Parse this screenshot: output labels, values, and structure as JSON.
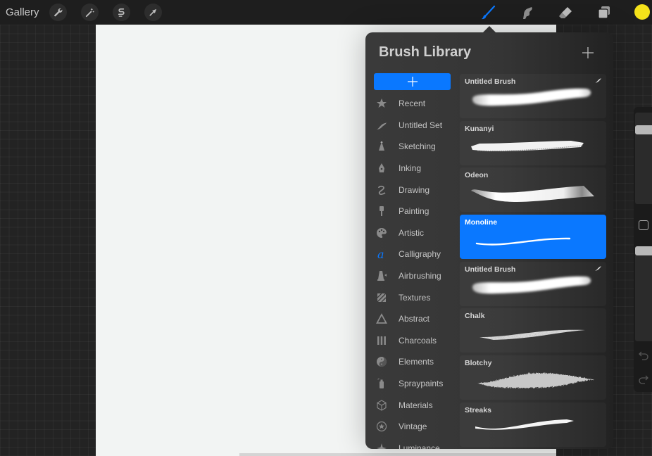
{
  "topbar": {
    "gallery_label": "Gallery",
    "left_tools": [
      {
        "name": "actions",
        "icon": "wrench-icon"
      },
      {
        "name": "adjustments",
        "icon": "magic-wand-icon"
      },
      {
        "name": "selection",
        "icon": "selection-s-icon"
      },
      {
        "name": "transform",
        "icon": "arrow-cursor-icon"
      }
    ],
    "right_tools": [
      {
        "name": "brush",
        "icon": "brush-icon",
        "active": true
      },
      {
        "name": "smudge",
        "icon": "smudge-finger-icon"
      },
      {
        "name": "eraser",
        "icon": "eraser-icon"
      },
      {
        "name": "layers",
        "icon": "layers-icon"
      }
    ],
    "current_color": "#f5e21a",
    "accent_color": "#0a78ff"
  },
  "brush_library": {
    "title": "Brush Library",
    "add_brush_icon": "plus-icon",
    "add_set_icon": "plus-icon",
    "sets": [
      {
        "label": "Recent",
        "icon": "star-icon"
      },
      {
        "label": "Untitled Set",
        "icon": "stroke-icon"
      },
      {
        "label": "Sketching",
        "icon": "pencil-tip-icon"
      },
      {
        "label": "Inking",
        "icon": "pen-nib-icon"
      },
      {
        "label": "Drawing",
        "icon": "squiggle-icon"
      },
      {
        "label": "Painting",
        "icon": "paintbrush-icon"
      },
      {
        "label": "Artistic",
        "icon": "palette-icon"
      },
      {
        "label": "Calligraphy",
        "icon": "calligraphy-a-icon",
        "selected": true
      },
      {
        "label": "Airbrushing",
        "icon": "airbrush-icon"
      },
      {
        "label": "Textures",
        "icon": "texture-icon"
      },
      {
        "label": "Abstract",
        "icon": "triangle-icon"
      },
      {
        "label": "Charcoals",
        "icon": "charcoal-sticks-icon"
      },
      {
        "label": "Elements",
        "icon": "yin-yang-icon"
      },
      {
        "label": "Spraypaints",
        "icon": "spray-can-icon"
      },
      {
        "label": "Materials",
        "icon": "cube-icon"
      },
      {
        "label": "Vintage",
        "icon": "circle-star-icon"
      },
      {
        "label": "Luminance",
        "icon": "sparkle-icon"
      }
    ],
    "brushes": [
      {
        "name": "Untitled Brush",
        "style": "soft",
        "custom": true
      },
      {
        "name": "Kunanyi",
        "style": "dry"
      },
      {
        "name": "Odeon",
        "style": "ribbon"
      },
      {
        "name": "Monoline",
        "style": "mono",
        "selected": true
      },
      {
        "name": "Untitled Brush",
        "style": "soft",
        "custom": true
      },
      {
        "name": "Chalk",
        "style": "chalk"
      },
      {
        "name": "Blotchy",
        "style": "blotchy"
      },
      {
        "name": "Streaks",
        "style": "streak"
      }
    ]
  },
  "sidebar": {
    "brush_size": 0.85,
    "opacity": 1.0,
    "modify_button_icon": "square-icon",
    "undo_icon": "undo-icon",
    "redo_icon": "redo-icon"
  }
}
